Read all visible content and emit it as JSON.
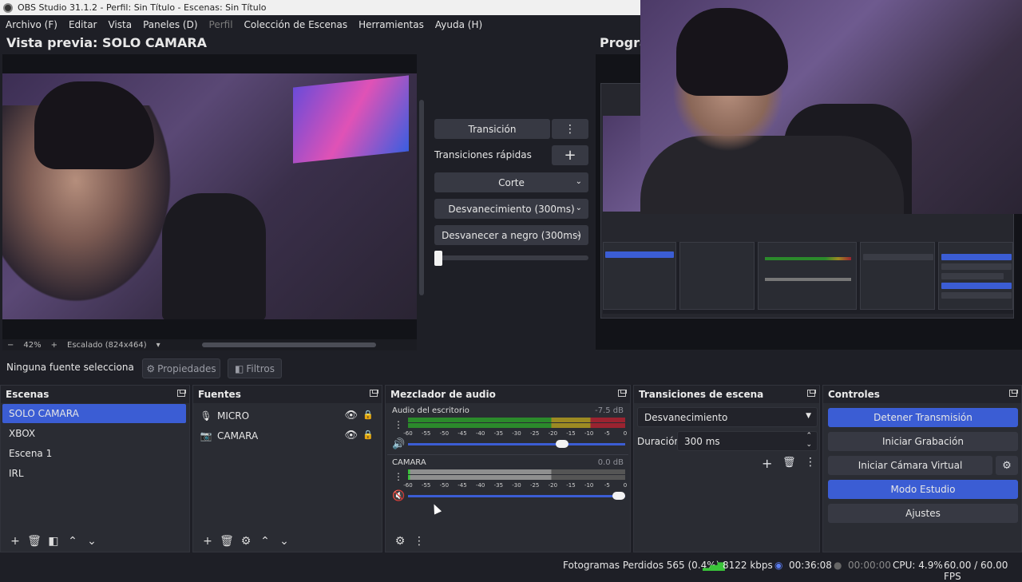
{
  "window": {
    "title": "OBS Studio 31.1.2 - Perfil: Sin Título - Escenas: Sin Título"
  },
  "menu": [
    {
      "label": "Archivo (F)",
      "disabled": false
    },
    {
      "label": "Editar",
      "disabled": false
    },
    {
      "label": "Vista",
      "disabled": false
    },
    {
      "label": "Paneles (D)",
      "disabled": false
    },
    {
      "label": "Perfil",
      "disabled": true
    },
    {
      "label": "Colección de Escenas",
      "disabled": false
    },
    {
      "label": "Herramientas",
      "disabled": false
    },
    {
      "label": "Ayuda (H)",
      "disabled": false
    }
  ],
  "preview": {
    "title": "Vista previa: SOLO CAMARA",
    "zoom_minus": "−",
    "zoom": "42%",
    "zoom_plus": "+",
    "scale": "Escalado (824x464)",
    "scale_chevron": "▾"
  },
  "program": {
    "title": "Progra"
  },
  "transitions_center": {
    "transition_button": "Transición",
    "more_icon": "⋮",
    "quick_label": "Transiciones rápidas",
    "add_icon": "+",
    "items": [
      "Corte",
      "Desvanecimiento (300ms)",
      "Desvanecer a negro (300ms)"
    ],
    "chevron": "⌄"
  },
  "source_toolbar": {
    "no_source": "Ninguna fuente selecciona",
    "properties": "Propiedades",
    "filters": "Filtros"
  },
  "scenes": {
    "title": "Escenas",
    "items": [
      "SOLO CAMARA",
      "XBOX",
      "Escena 1",
      "IRL"
    ],
    "active_index": 0
  },
  "sources": {
    "title": "Fuentes",
    "items": [
      {
        "name": "MICRO",
        "icon": "microphone-icon"
      },
      {
        "name": "CAMARA",
        "icon": "camera-icon"
      }
    ]
  },
  "mixer": {
    "title": "Mezclador de audio",
    "scale": [
      "-60",
      "-55",
      "-50",
      "-45",
      "-40",
      "-35",
      "-30",
      "-25",
      "-20",
      "-15",
      "-10",
      "-5",
      "0"
    ],
    "channels": [
      {
        "name": "Audio del escritorio",
        "db": "-7.5 dB",
        "muted": false,
        "volume": 0.74
      },
      {
        "name": "CAMARA",
        "db": "0.0 dB",
        "muted": true,
        "volume": 1.0
      }
    ]
  },
  "scene_transitions": {
    "title": "Transiciones de escena",
    "selected": "Desvanecimiento",
    "duration_label": "Duración",
    "duration_value": "300 ms"
  },
  "controls": {
    "title": "Controles",
    "stop_stream": "Detener Transmisión",
    "start_recording": "Iniciar Grabación",
    "start_virtualcam": "Iniciar Cámara Virtual",
    "studio_mode": "Modo Estudio",
    "settings": "Ajustes"
  },
  "status": {
    "dropped_frames": "Fotogramas Perdidos 565 (0.4%)",
    "bitrate": "8122 kbps",
    "stream_time": "00:36:08",
    "rec_time": "00:00:00",
    "cpu": "CPU: 4.9%",
    "fps": "60.00 / 60.00 FPS"
  },
  "colors": {
    "accent": "#3b5dd4",
    "panel": "#2a2c33",
    "background": "#1e1f26",
    "meter_green": "#2b8a2b",
    "meter_yellow": "#9c8a22",
    "meter_red": "#9a2330"
  }
}
